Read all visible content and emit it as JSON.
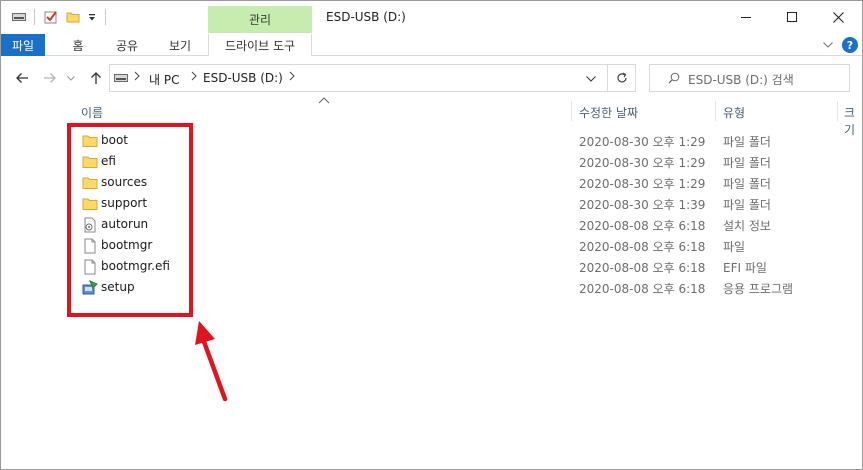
{
  "window": {
    "title": "ESD-USB (D:)",
    "context_tab_group": "관리"
  },
  "ribbon": {
    "tabs": [
      {
        "label": "파일"
      },
      {
        "label": "홈"
      },
      {
        "label": "공유"
      },
      {
        "label": "보기"
      },
      {
        "label": "드라이브 도구"
      }
    ]
  },
  "address": {
    "breadcrumbs": [
      "내 PC",
      "ESD-USB (D:)"
    ],
    "search_placeholder": "ESD-USB (D:) 검색"
  },
  "columns": [
    "이름",
    "수정한 날짜",
    "유형",
    "크기"
  ],
  "files": [
    {
      "name": "boot",
      "modified": "2020-08-30 오후 1:29",
      "type": "파일 폴더",
      "icon": "folder-icon"
    },
    {
      "name": "efi",
      "modified": "2020-08-30 오후 1:29",
      "type": "파일 폴더",
      "icon": "folder-icon"
    },
    {
      "name": "sources",
      "modified": "2020-08-30 오후 1:29",
      "type": "파일 폴더",
      "icon": "folder-icon"
    },
    {
      "name": "support",
      "modified": "2020-08-30 오후 1:39",
      "type": "파일 폴더",
      "icon": "folder-icon"
    },
    {
      "name": "autorun",
      "modified": "2020-08-08 오후 6:18",
      "type": "설치 정보",
      "icon": "setup-info-file-icon"
    },
    {
      "name": "bootmgr",
      "modified": "2020-08-08 오후 6:18",
      "type": "파일",
      "icon": "file-icon"
    },
    {
      "name": "bootmgr.efi",
      "modified": "2020-08-08 오후 6:18",
      "type": "EFI 파일",
      "icon": "file-icon"
    },
    {
      "name": "setup",
      "modified": "2020-08-08 오후 6:18",
      "type": "응용 프로그램",
      "icon": "setup-app-icon"
    }
  ],
  "colors": {
    "file_tab": "#1a6fc9",
    "context_tab": "#c7ecb0",
    "annotation": "#e0141e",
    "folder": "#ffd866"
  }
}
